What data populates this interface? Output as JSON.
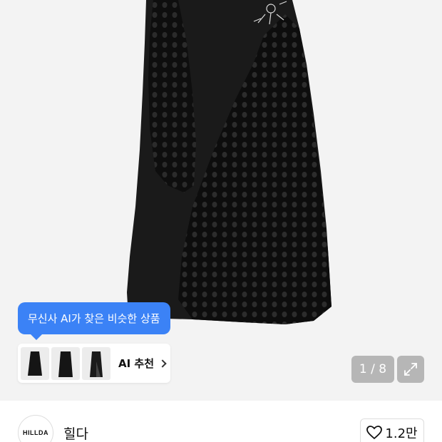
{
  "product": {
    "image_alt": "black mesh skirt",
    "pager": {
      "current": 1,
      "total": 8,
      "text": "1 / 8"
    }
  },
  "ai": {
    "tooltip": "무신사 AI가 찾은 비슷한 상품",
    "recommend_label": "AI 추천",
    "thumbnails": [
      "similar-item-1",
      "similar-item-2",
      "similar-item-3"
    ]
  },
  "brand": {
    "logo_text": "HILLDA",
    "name": "힐다",
    "likes": "1.2만"
  },
  "colors": {
    "accent": "#3b82f6",
    "garment": "#121212"
  },
  "icons": {
    "expand": "expand-icon",
    "heart": "heart-icon",
    "chevron": "chevron-right-icon"
  }
}
